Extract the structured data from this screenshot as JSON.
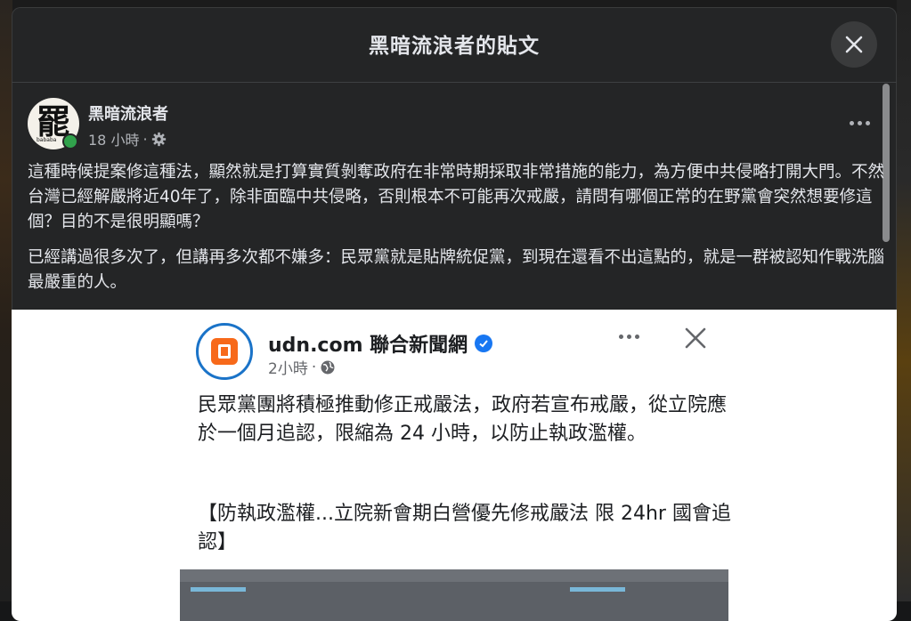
{
  "modal": {
    "title": "黑暗流浪者的貼文"
  },
  "post": {
    "author": "黑暗流浪者",
    "avatar_char": "罷",
    "avatar_sub": "bababa",
    "time": "18 小時",
    "separator": "·",
    "paragraphs": [
      "這種時候提案修這種法，顯然就是打算實質剝奪政府在非常時期採取非常措施的能力，為方便中共侵略打開大門。不然台灣已經解嚴將近40年了，除非面臨中共侵略，否則根本不可能再次戒嚴，請問有哪個正常的在野黨會突然想要修這個？目的不是很明顯嗎？",
      "已經講過很多次了，但講再多次都不嫌多：民眾黨就是貼牌統促黨，到現在還看不出這點的，就是一群被認知作戰洗腦最嚴重的人。"
    ]
  },
  "shared": {
    "page_name": "udn.com 聯合新聞網",
    "time": "2小時",
    "separator": "·",
    "body": "民眾黨團將積極推動修正戒嚴法，政府若宣布戒嚴，從立院應於一個月追認，限縮為 24 小時，以防止執政濫權。",
    "headline": "【防執政濫權...立院新會期白營優先修戒嚴法 限 24hr 國會追認】"
  },
  "colors": {
    "modal_bg": "#242526",
    "text_primary": "#e4e6eb",
    "text_secondary": "#b0b3b8",
    "online": "#31a24c",
    "verified": "#1877f2",
    "udn_orange": "#f7691a"
  },
  "icons": [
    "close-icon",
    "gear-icon",
    "more-icon",
    "verified-icon",
    "globe-icon"
  ]
}
